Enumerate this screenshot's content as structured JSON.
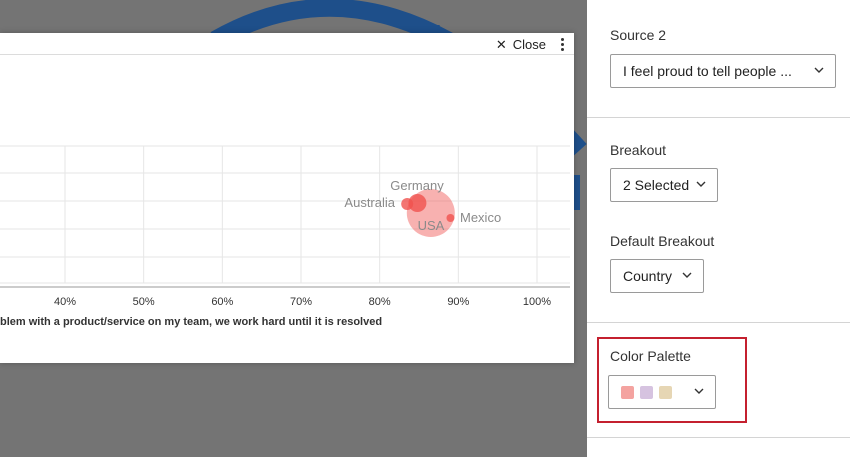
{
  "modal": {
    "close_label": "Close"
  },
  "chart_data": {
    "type": "scatter",
    "x_tick_labels": [
      "40%",
      "50%",
      "60%",
      "70%",
      "80%",
      "90%",
      "100%"
    ],
    "x_ticks": [
      40,
      50,
      60,
      70,
      80,
      90,
      100
    ],
    "xlabel": "blem with a product/service on my team, we work hard until it is resolved",
    "points": [
      {
        "label": "Australia",
        "x": 83.5,
        "size": "small"
      },
      {
        "label": "Germany",
        "x": 84.8,
        "size": "small"
      },
      {
        "label": "USA",
        "x": 86.5,
        "size": "large"
      },
      {
        "label": "Mexico",
        "x": 89.0,
        "size": "tiny"
      }
    ],
    "point_color": "#f0524f"
  },
  "panel": {
    "source2": {
      "label": "Source 2",
      "value": "I feel proud to tell people ..."
    },
    "breakout": {
      "label": "Breakout",
      "value": "2 Selected"
    },
    "default_breakout": {
      "label": "Default Breakout",
      "value": "Country"
    },
    "color_palette": {
      "label": "Color Palette",
      "swatches": [
        "#f4a3a0",
        "#d6c3e0",
        "#e6d6b4"
      ]
    }
  }
}
